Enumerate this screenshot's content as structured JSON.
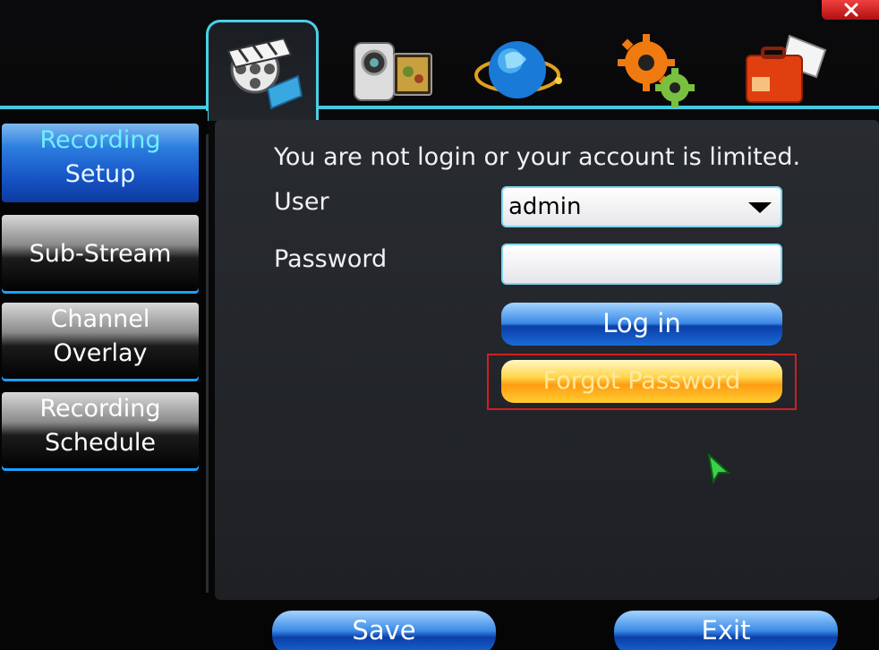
{
  "sidebar": {
    "items": [
      {
        "line1": "Recording",
        "line2": "Setup"
      },
      {
        "line1": "Sub-Stream",
        "line2": ""
      },
      {
        "line1": "Channel",
        "line2": "Overlay"
      },
      {
        "line1": "Recording",
        "line2": "Schedule"
      }
    ]
  },
  "login": {
    "message": "You are not login or your account is limited.",
    "user_label": "User",
    "user_value": "admin",
    "password_label": "Password",
    "password_value": "",
    "login_button": "Log in",
    "forgot_button": "Forgot Password"
  },
  "footer": {
    "save": "Save",
    "exit": "Exit"
  },
  "icons": {
    "tab1": "film-reel-icon",
    "tab2": "camcorder-icon",
    "tab3": "network-globe-icon",
    "tab4": "gears-icon",
    "tab5": "toolbox-icon",
    "close": "close-icon",
    "cursor": "mouse-pointer-icon"
  },
  "colors": {
    "accent": "#44c8e0",
    "active_tab_text": "#6ef0ff",
    "highlight_box": "#d02020"
  }
}
